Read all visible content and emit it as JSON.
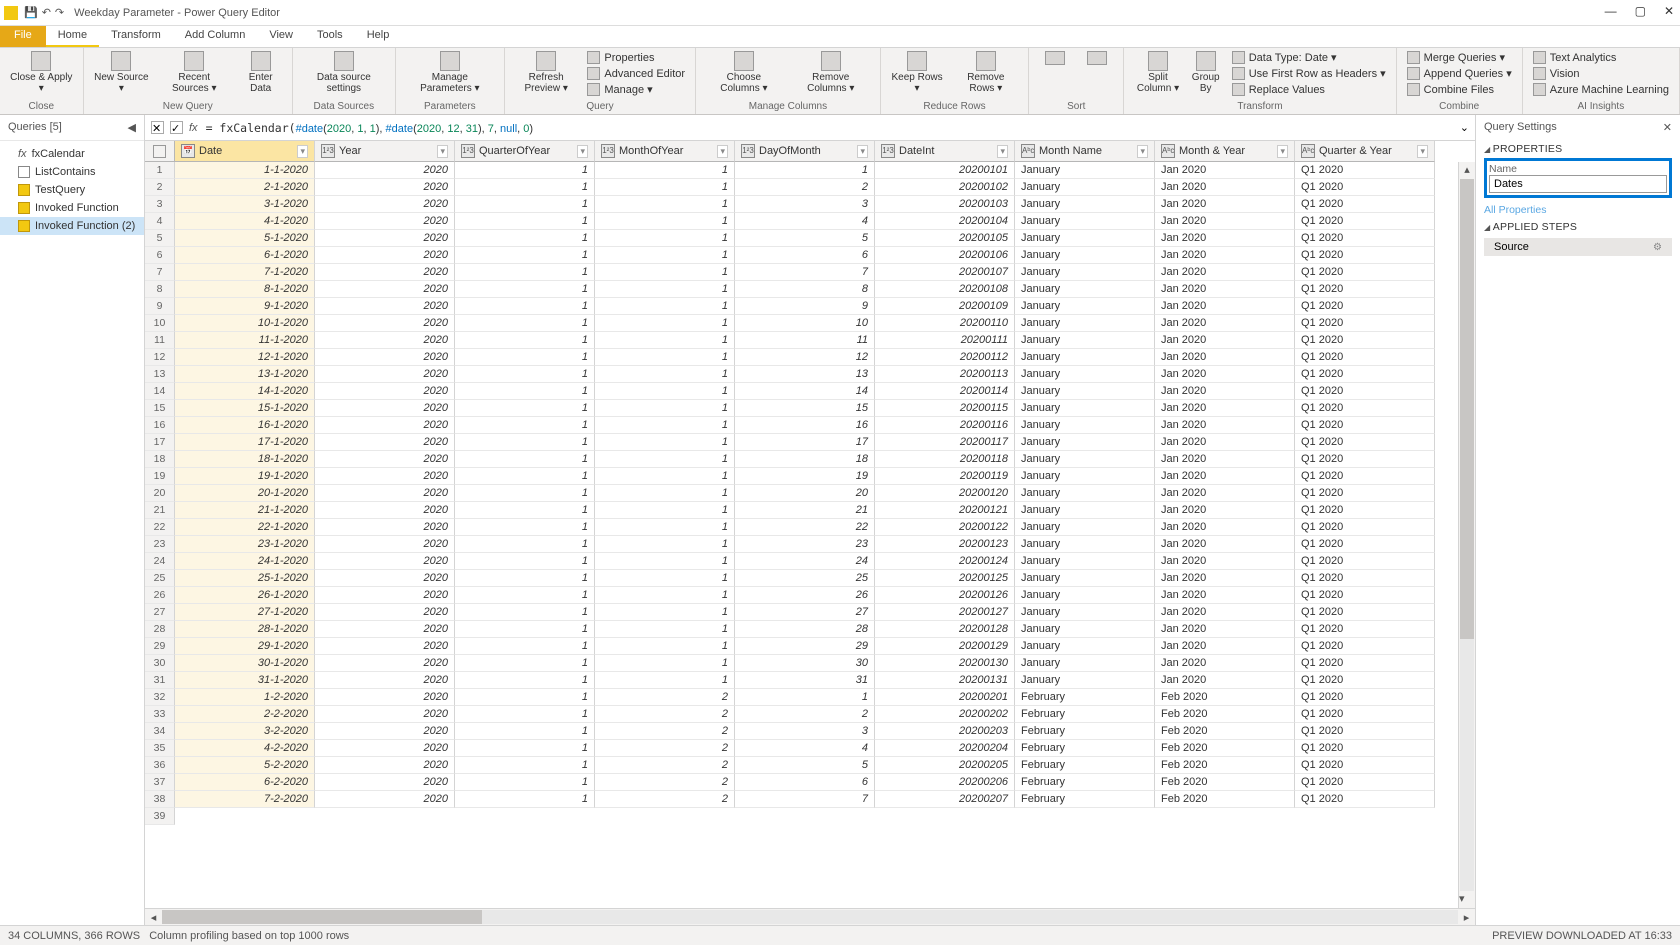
{
  "titlebar": {
    "title": "Weekday Parameter - Power Query Editor"
  },
  "tabs": [
    "File",
    "Home",
    "Transform",
    "Add Column",
    "View",
    "Tools",
    "Help"
  ],
  "active_tab": "Home",
  "ribbon": {
    "close": {
      "label": "Close &\nApply ▾",
      "group": "Close"
    },
    "newquery": {
      "btns": [
        {
          "label": "New\nSource ▾"
        },
        {
          "label": "Recent\nSources ▾"
        },
        {
          "label": "Enter\nData"
        }
      ],
      "group": "New Query"
    },
    "datasources": {
      "btns": [
        {
          "label": "Data source\nsettings"
        }
      ],
      "group": "Data Sources"
    },
    "parameters": {
      "btns": [
        {
          "label": "Manage\nParameters ▾"
        }
      ],
      "group": "Parameters"
    },
    "refresh": {
      "btn": {
        "label": "Refresh\nPreview ▾"
      },
      "side": [
        {
          "label": "Properties"
        },
        {
          "label": "Advanced Editor"
        },
        {
          "label": "Manage ▾"
        }
      ],
      "group": "Query"
    },
    "managecols": {
      "btns": [
        {
          "label": "Choose\nColumns ▾"
        },
        {
          "label": "Remove\nColumns ▾"
        }
      ],
      "group": "Manage Columns"
    },
    "rows": {
      "btns": [
        {
          "label": "Keep\nRows ▾"
        },
        {
          "label": "Remove\nRows ▾"
        }
      ],
      "group": "Reduce Rows"
    },
    "sort": {
      "group": "Sort"
    },
    "split": {
      "btns": [
        {
          "label": "Split\nColumn ▾"
        },
        {
          "label": "Group\nBy"
        }
      ],
      "side": [
        {
          "label": "Data Type: Date ▾"
        },
        {
          "label": "Use First Row as Headers ▾"
        },
        {
          "label": "Replace Values"
        }
      ],
      "group": "Transform"
    },
    "combine": {
      "side": [
        {
          "label": "Merge Queries ▾"
        },
        {
          "label": "Append Queries ▾"
        },
        {
          "label": "Combine Files"
        }
      ],
      "group": "Combine"
    },
    "ai": {
      "side": [
        {
          "label": "Text Analytics"
        },
        {
          "label": "Vision"
        },
        {
          "label": "Azure Machine Learning"
        }
      ],
      "group": "AI Insights"
    }
  },
  "queries": {
    "header": "Queries [5]",
    "items": [
      {
        "name": "fxCalendar",
        "type": "fx"
      },
      {
        "name": "ListContains",
        "type": "list"
      },
      {
        "name": "TestQuery",
        "type": "tbl"
      },
      {
        "name": "Invoked Function",
        "type": "tbl"
      },
      {
        "name": "Invoked Function (2)",
        "type": "tbl",
        "sel": true
      }
    ]
  },
  "formula": {
    "prefix": "= fxCalendar(",
    "segments": [
      {
        "t": "#date",
        "c": "kw"
      },
      {
        "t": "("
      },
      {
        "t": "2020",
        "c": "num"
      },
      {
        "t": ", "
      },
      {
        "t": "1",
        "c": "num"
      },
      {
        "t": ", "
      },
      {
        "t": "1",
        "c": "num"
      },
      {
        "t": "), "
      },
      {
        "t": "#date",
        "c": "kw"
      },
      {
        "t": "("
      },
      {
        "t": "2020",
        "c": "num"
      },
      {
        "t": ", "
      },
      {
        "t": "12",
        "c": "num"
      },
      {
        "t": ", "
      },
      {
        "t": "31",
        "c": "num"
      },
      {
        "t": "), "
      },
      {
        "t": "7",
        "c": "num"
      },
      {
        "t": ", "
      },
      {
        "t": "null",
        "c": "nul"
      },
      {
        "t": ", "
      },
      {
        "t": "0",
        "c": "num"
      },
      {
        "t": ")"
      }
    ]
  },
  "columns": [
    {
      "name": "Date",
      "type": "📅",
      "sel": true
    },
    {
      "name": "Year",
      "type": "1²3"
    },
    {
      "name": "QuarterOfYear",
      "type": "1²3"
    },
    {
      "name": "MonthOfYear",
      "type": "1²3"
    },
    {
      "name": "DayOfMonth",
      "type": "1²3"
    },
    {
      "name": "DateInt",
      "type": "1²3"
    },
    {
      "name": "Month Name",
      "type": "Aᵇc"
    },
    {
      "name": "Month & Year",
      "type": "Aᵇc"
    },
    {
      "name": "Quarter & Year",
      "type": "Aᵇc"
    }
  ],
  "rows": [
    [
      "1-1-2020",
      "2020",
      "1",
      "1",
      "1",
      "20200101",
      "January",
      "Jan 2020",
      "Q1 2020"
    ],
    [
      "2-1-2020",
      "2020",
      "1",
      "1",
      "2",
      "20200102",
      "January",
      "Jan 2020",
      "Q1 2020"
    ],
    [
      "3-1-2020",
      "2020",
      "1",
      "1",
      "3",
      "20200103",
      "January",
      "Jan 2020",
      "Q1 2020"
    ],
    [
      "4-1-2020",
      "2020",
      "1",
      "1",
      "4",
      "20200104",
      "January",
      "Jan 2020",
      "Q1 2020"
    ],
    [
      "5-1-2020",
      "2020",
      "1",
      "1",
      "5",
      "20200105",
      "January",
      "Jan 2020",
      "Q1 2020"
    ],
    [
      "6-1-2020",
      "2020",
      "1",
      "1",
      "6",
      "20200106",
      "January",
      "Jan 2020",
      "Q1 2020"
    ],
    [
      "7-1-2020",
      "2020",
      "1",
      "1",
      "7",
      "20200107",
      "January",
      "Jan 2020",
      "Q1 2020"
    ],
    [
      "8-1-2020",
      "2020",
      "1",
      "1",
      "8",
      "20200108",
      "January",
      "Jan 2020",
      "Q1 2020"
    ],
    [
      "9-1-2020",
      "2020",
      "1",
      "1",
      "9",
      "20200109",
      "January",
      "Jan 2020",
      "Q1 2020"
    ],
    [
      "10-1-2020",
      "2020",
      "1",
      "1",
      "10",
      "20200110",
      "January",
      "Jan 2020",
      "Q1 2020"
    ],
    [
      "11-1-2020",
      "2020",
      "1",
      "1",
      "11",
      "20200111",
      "January",
      "Jan 2020",
      "Q1 2020"
    ],
    [
      "12-1-2020",
      "2020",
      "1",
      "1",
      "12",
      "20200112",
      "January",
      "Jan 2020",
      "Q1 2020"
    ],
    [
      "13-1-2020",
      "2020",
      "1",
      "1",
      "13",
      "20200113",
      "January",
      "Jan 2020",
      "Q1 2020"
    ],
    [
      "14-1-2020",
      "2020",
      "1",
      "1",
      "14",
      "20200114",
      "January",
      "Jan 2020",
      "Q1 2020"
    ],
    [
      "15-1-2020",
      "2020",
      "1",
      "1",
      "15",
      "20200115",
      "January",
      "Jan 2020",
      "Q1 2020"
    ],
    [
      "16-1-2020",
      "2020",
      "1",
      "1",
      "16",
      "20200116",
      "January",
      "Jan 2020",
      "Q1 2020"
    ],
    [
      "17-1-2020",
      "2020",
      "1",
      "1",
      "17",
      "20200117",
      "January",
      "Jan 2020",
      "Q1 2020"
    ],
    [
      "18-1-2020",
      "2020",
      "1",
      "1",
      "18",
      "20200118",
      "January",
      "Jan 2020",
      "Q1 2020"
    ],
    [
      "19-1-2020",
      "2020",
      "1",
      "1",
      "19",
      "20200119",
      "January",
      "Jan 2020",
      "Q1 2020"
    ],
    [
      "20-1-2020",
      "2020",
      "1",
      "1",
      "20",
      "20200120",
      "January",
      "Jan 2020",
      "Q1 2020"
    ],
    [
      "21-1-2020",
      "2020",
      "1",
      "1",
      "21",
      "20200121",
      "January",
      "Jan 2020",
      "Q1 2020"
    ],
    [
      "22-1-2020",
      "2020",
      "1",
      "1",
      "22",
      "20200122",
      "January",
      "Jan 2020",
      "Q1 2020"
    ],
    [
      "23-1-2020",
      "2020",
      "1",
      "1",
      "23",
      "20200123",
      "January",
      "Jan 2020",
      "Q1 2020"
    ],
    [
      "24-1-2020",
      "2020",
      "1",
      "1",
      "24",
      "20200124",
      "January",
      "Jan 2020",
      "Q1 2020"
    ],
    [
      "25-1-2020",
      "2020",
      "1",
      "1",
      "25",
      "20200125",
      "January",
      "Jan 2020",
      "Q1 2020"
    ],
    [
      "26-1-2020",
      "2020",
      "1",
      "1",
      "26",
      "20200126",
      "January",
      "Jan 2020",
      "Q1 2020"
    ],
    [
      "27-1-2020",
      "2020",
      "1",
      "1",
      "27",
      "20200127",
      "January",
      "Jan 2020",
      "Q1 2020"
    ],
    [
      "28-1-2020",
      "2020",
      "1",
      "1",
      "28",
      "20200128",
      "January",
      "Jan 2020",
      "Q1 2020"
    ],
    [
      "29-1-2020",
      "2020",
      "1",
      "1",
      "29",
      "20200129",
      "January",
      "Jan 2020",
      "Q1 2020"
    ],
    [
      "30-1-2020",
      "2020",
      "1",
      "1",
      "30",
      "20200130",
      "January",
      "Jan 2020",
      "Q1 2020"
    ],
    [
      "31-1-2020",
      "2020",
      "1",
      "1",
      "31",
      "20200131",
      "January",
      "Jan 2020",
      "Q1 2020"
    ],
    [
      "1-2-2020",
      "2020",
      "1",
      "2",
      "1",
      "20200201",
      "February",
      "Feb 2020",
      "Q1 2020"
    ],
    [
      "2-2-2020",
      "2020",
      "1",
      "2",
      "2",
      "20200202",
      "February",
      "Feb 2020",
      "Q1 2020"
    ],
    [
      "3-2-2020",
      "2020",
      "1",
      "2",
      "3",
      "20200203",
      "February",
      "Feb 2020",
      "Q1 2020"
    ],
    [
      "4-2-2020",
      "2020",
      "1",
      "2",
      "4",
      "20200204",
      "February",
      "Feb 2020",
      "Q1 2020"
    ],
    [
      "5-2-2020",
      "2020",
      "1",
      "2",
      "5",
      "20200205",
      "February",
      "Feb 2020",
      "Q1 2020"
    ],
    [
      "6-2-2020",
      "2020",
      "1",
      "2",
      "6",
      "20200206",
      "February",
      "Feb 2020",
      "Q1 2020"
    ],
    [
      "7-2-2020",
      "2020",
      "1",
      "2",
      "7",
      "20200207",
      "February",
      "Feb 2020",
      "Q1 2020"
    ]
  ],
  "extra_row_number": "39",
  "settings": {
    "header": "Query Settings",
    "properties": "Properties",
    "name_label": "Name",
    "name_value": "Dates",
    "all_props": "All Properties",
    "applied": "Applied Steps",
    "steps": [
      "Source"
    ]
  },
  "status": {
    "left": "34 COLUMNS, 366 ROWS",
    "mid": "Column profiling based on top 1000 rows",
    "right": "PREVIEW DOWNLOADED AT 16:33"
  }
}
